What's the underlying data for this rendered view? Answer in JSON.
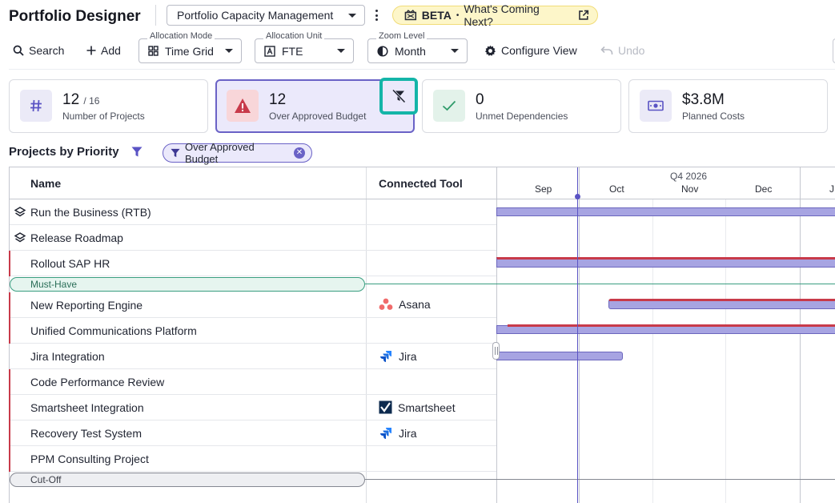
{
  "app": {
    "title": "Portfolio Designer"
  },
  "header": {
    "view_selector": "Portfolio Capacity Management",
    "beta_tag": "BETA",
    "beta_dot": "•",
    "beta_text": "What's Coming Next?"
  },
  "toolbar": {
    "search_label": "Search",
    "add_label": "Add",
    "allocation_mode": {
      "label": "Allocation Mode",
      "value": "Time Grid"
    },
    "allocation_unit": {
      "label": "Allocation Unit",
      "value": "FTE"
    },
    "zoom_level": {
      "label": "Zoom Level",
      "value": "Month"
    },
    "configure_view_label": "Configure View",
    "undo_label": "Undo"
  },
  "kpis": [
    {
      "value": "12",
      "sub": "/ 16",
      "label": "Number of Projects",
      "icon": "hash-icon"
    },
    {
      "value": "12",
      "sub": "",
      "label": "Over Approved Budget",
      "icon": "warning-triangle-icon",
      "active": true
    },
    {
      "value": "0",
      "sub": "",
      "label": "Unmet Dependencies",
      "icon": "checkmark-icon"
    },
    {
      "value": "$3.8M",
      "sub": "",
      "label": "Planned Costs",
      "icon": "money-icon"
    }
  ],
  "section": {
    "title": "Projects by Priority",
    "filter_chip": "Over Approved Budget"
  },
  "grid": {
    "columns": {
      "name": "Name",
      "tool": "Connected Tool"
    },
    "timeline": {
      "quarter": "Q4 2026",
      "months": [
        "Sep",
        "Oct",
        "Nov",
        "Dec",
        "J"
      ]
    },
    "rows": [
      {
        "name": "Run the Business (RTB)",
        "type": "group",
        "tool": ""
      },
      {
        "name": "Release Roadmap",
        "type": "group",
        "tool": ""
      },
      {
        "name": "Rollout SAP HR",
        "type": "project",
        "tool": "",
        "flag": true
      },
      {
        "name": "New Reporting Engine",
        "type": "project",
        "tool": "Asana",
        "flag": true
      },
      {
        "name": "Unified Communications Platform",
        "type": "project",
        "tool": "",
        "flag": true
      },
      {
        "name": "Jira Integration",
        "type": "project",
        "tool": "Jira",
        "flag": false
      },
      {
        "name": "Code Performance Review",
        "type": "project",
        "tool": "",
        "flag": true
      },
      {
        "name": "Smartsheet Integration",
        "type": "project",
        "tool": "Smartsheet",
        "flag": true
      },
      {
        "name": "Recovery Test System",
        "type": "project",
        "tool": "Jira",
        "flag": true
      },
      {
        "name": "PPM Consulting Project",
        "type": "project",
        "tool": "",
        "flag": true
      }
    ],
    "dividers": {
      "must_have": "Must-Have",
      "cut_off": "Cut-Off"
    }
  },
  "colors": {
    "accent": "#6a62c6",
    "bar_fill": "#a7a4e2",
    "risk": "#c83a4a",
    "highlight": "#14b5a8",
    "beta_bg": "#fdf6c9"
  }
}
